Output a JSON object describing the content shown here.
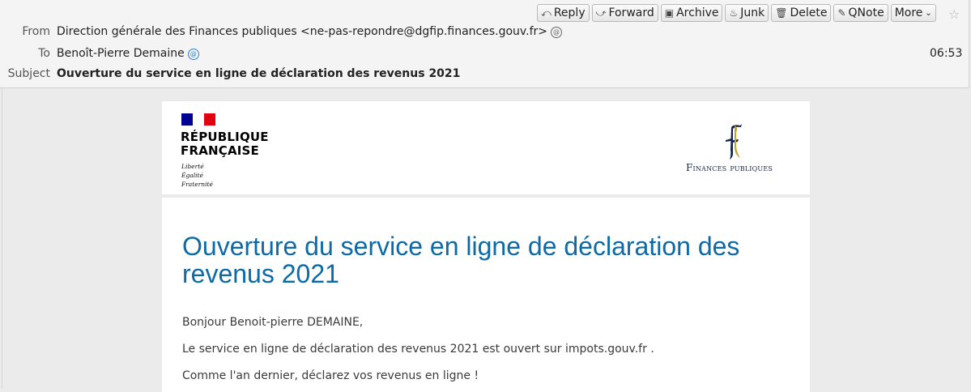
{
  "toolbar": {
    "buttons": [
      {
        "label": "Reply",
        "icon": "reply-icon",
        "glyph": "⤺"
      },
      {
        "label": "Forward",
        "icon": "forward-icon",
        "glyph": "⤻"
      },
      {
        "label": "Archive",
        "icon": "archive-icon",
        "glyph": "▣"
      },
      {
        "label": "Junk",
        "icon": "junk-icon",
        "glyph": "♨"
      },
      {
        "label": "Delete",
        "icon": "trash-icon",
        "glyph": "🗑"
      },
      {
        "label": "QNote",
        "icon": "qnote-icon",
        "glyph": "✎"
      },
      {
        "label": "More",
        "icon": "chevron-down-icon",
        "glyph": "⌄"
      }
    ]
  },
  "headers": {
    "from_label": "From",
    "from_value": "Direction générale des Finances publiques <ne-pas-repondre@dgfip.finances.gouv.fr>",
    "to_label": "To",
    "to_value": "Benoît-Pierre Demaine",
    "subject_label": "Subject",
    "subject_value": "Ouverture du service en ligne de déclaration des revenus 2021",
    "time": "06:53"
  },
  "email": {
    "rf_line1": "RÉPUBLIQUE",
    "rf_line2": "FRANÇAISE",
    "motto": [
      "Liberté",
      "Égalité",
      "Fraternité"
    ],
    "fp_logo_text": "Finances publiques",
    "title": "Ouverture du service en ligne de déclaration des revenus 2021",
    "paragraphs": [
      "Bonjour Benoit-pierre DEMAINE,",
      "Le service en ligne de déclaration des revenus 2021 est ouvert sur impots.gouv.fr .",
      "Comme l'an dernier, déclarez vos revenus en ligne  !"
    ]
  },
  "colors": {
    "title_blue": "#0d6aa6",
    "flag_blue": "#000091",
    "flag_red": "#e1000f",
    "fp_navy": "#16264a",
    "fp_gold": "#c9a227"
  }
}
